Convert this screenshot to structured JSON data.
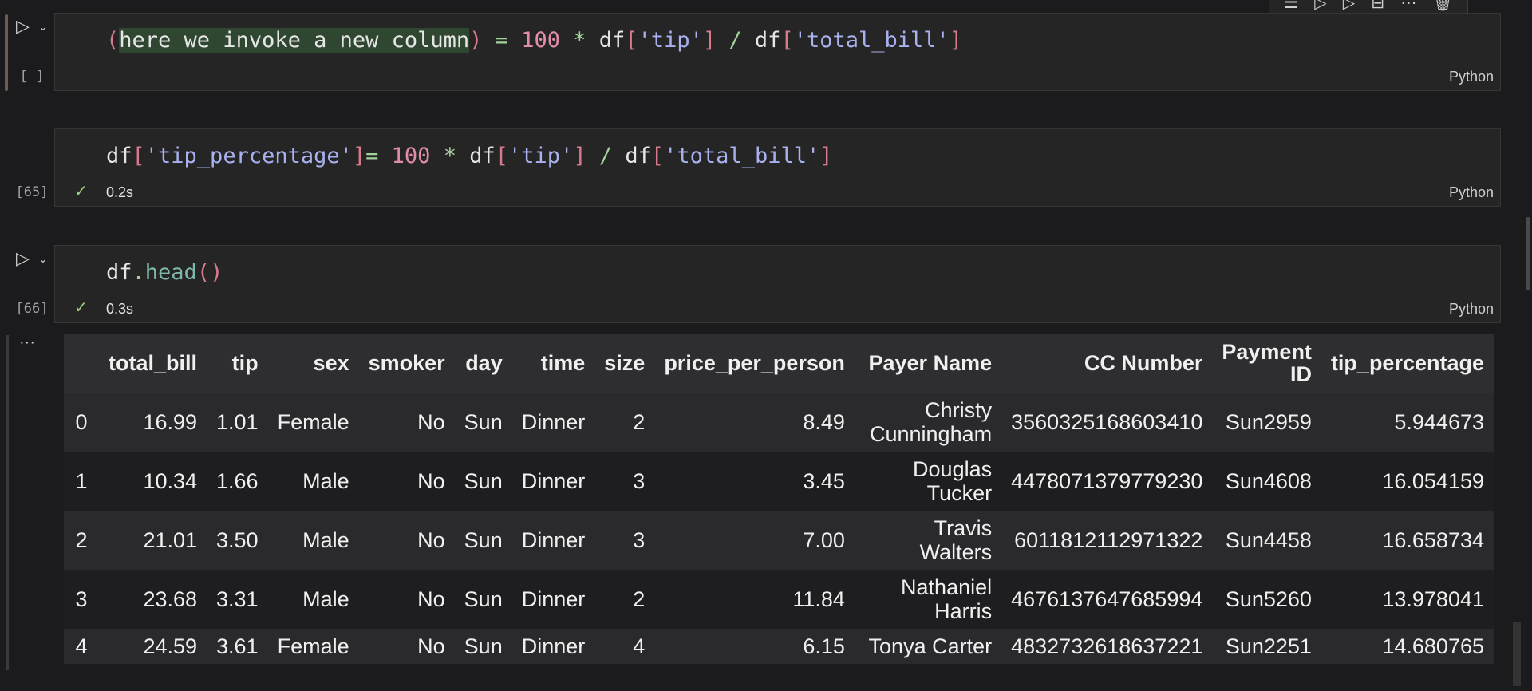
{
  "toolbar": {
    "icons": [
      "run-by-line-icon",
      "execute-above-icon",
      "execute-below-icon",
      "split-cell-icon",
      "more-icon",
      "delete-icon"
    ]
  },
  "cells": [
    {
      "execution_count": "[ ]",
      "code": "(here we invoke a new column) = 100 * df['tip'] / df['total_bill']",
      "language": "Python"
    },
    {
      "execution_count": "[65]",
      "code": "df['tip_percentage']= 100 * df['tip'] / df['total_bill']",
      "status": "✓",
      "duration": "0.2s",
      "language": "Python"
    },
    {
      "execution_count": "[66]",
      "code": "df.head()",
      "status": "✓",
      "duration": "0.3s",
      "language": "Python"
    }
  ],
  "output": {
    "more_label": "···",
    "columns": [
      "",
      "total_bill",
      "tip",
      "sex",
      "smoker",
      "day",
      "time",
      "size",
      "price_per_person",
      "Payer Name",
      "CC Number",
      "Payment ID",
      "tip_percentage"
    ],
    "rows": [
      [
        "0",
        "16.99",
        "1.01",
        "Female",
        "No",
        "Sun",
        "Dinner",
        "2",
        "8.49",
        "Christy Cunningham",
        "3560325168603410",
        "Sun2959",
        "5.944673"
      ],
      [
        "1",
        "10.34",
        "1.66",
        "Male",
        "No",
        "Sun",
        "Dinner",
        "3",
        "3.45",
        "Douglas Tucker",
        "4478071379779230",
        "Sun4608",
        "16.054159"
      ],
      [
        "2",
        "21.01",
        "3.50",
        "Male",
        "No",
        "Sun",
        "Dinner",
        "3",
        "7.00",
        "Travis Walters",
        "6011812112971322",
        "Sun4458",
        "16.658734"
      ],
      [
        "3",
        "23.68",
        "3.31",
        "Male",
        "No",
        "Sun",
        "Dinner",
        "2",
        "11.84",
        "Nathaniel Harris",
        "4676137647685994",
        "Sun5260",
        "13.978041"
      ],
      [
        "4",
        "24.59",
        "3.61",
        "Female",
        "No",
        "Sun",
        "Dinner",
        "4",
        "6.15",
        "Tonya Carter",
        "4832732618637221",
        "Sun2251",
        "14.680765"
      ]
    ]
  }
}
